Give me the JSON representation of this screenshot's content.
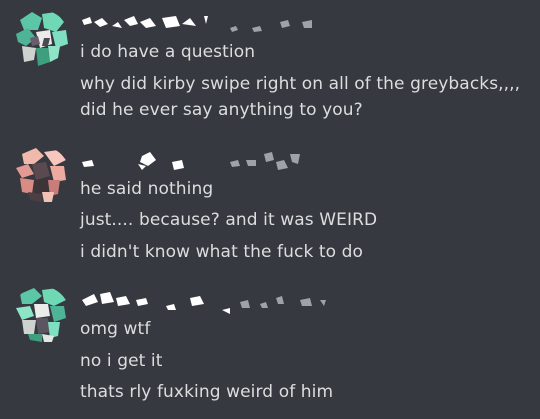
{
  "messages": [
    {
      "lines": [
        "i do have a question",
        "why did kirby swipe right on all of the greybacks,,,,",
        "did he ever say anything to you?"
      ]
    },
    {
      "lines": [
        "he said nothing",
        "just.... because? and it was WEIRD",
        "i didn't know what the fuck to do"
      ]
    },
    {
      "lines": [
        "omg wtf",
        "no i get it",
        "thats rly fuxking weird of him"
      ]
    }
  ]
}
